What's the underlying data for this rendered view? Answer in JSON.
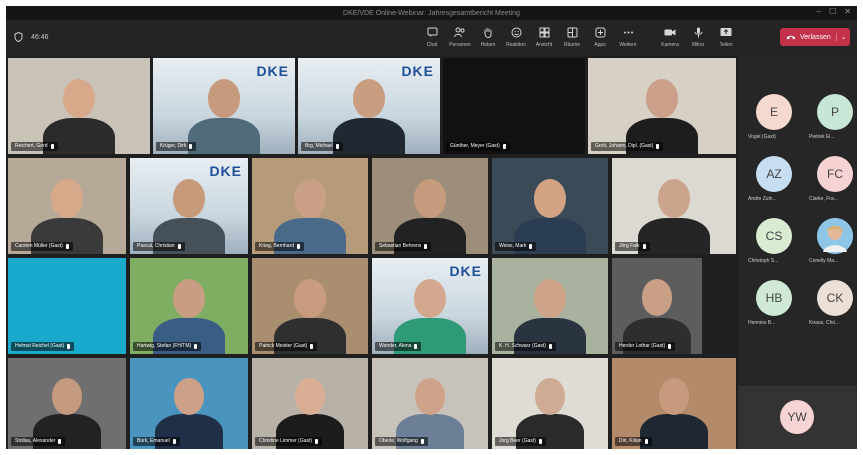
{
  "window": {
    "title": "DKE/VDE Online-Webinar: Jahresgesamtbericht Meeting",
    "controls": [
      "–",
      "☐",
      "✕"
    ]
  },
  "toolbar": {
    "shield_icon": "shield-icon",
    "timer": "46:46",
    "buttons": [
      {
        "label": "Chat",
        "icon": "chat-icon"
      },
      {
        "label": "Personen",
        "icon": "people-icon"
      },
      {
        "label": "Heben",
        "icon": "raise-hand-icon"
      },
      {
        "label": "Reaktion",
        "icon": "reaction-icon"
      },
      {
        "label": "Ansicht",
        "icon": "grid-view-icon"
      },
      {
        "label": "Räume",
        "icon": "rooms-icon"
      },
      {
        "label": "Apps",
        "icon": "apps-icon"
      },
      {
        "label": "Weitere",
        "icon": "more-icon"
      },
      {
        "label": "Kamera",
        "icon": "camera-icon"
      },
      {
        "label": "Mikro",
        "icon": "mic-icon"
      },
      {
        "label": "Teilen",
        "icon": "share-icon"
      }
    ],
    "leave_label": "Verlassen"
  },
  "tiles": [
    {
      "name": "Reichert, Gerd",
      "bg": "#c9c2b7",
      "skin": "#d7a98a",
      "shirt": "#2b2b2b",
      "dke": false
    },
    {
      "name": "Krüger, Dirk",
      "bg": "#dfe6ea",
      "skin": "#c69a7c",
      "shirt": "#4f6b7a",
      "dke": true
    },
    {
      "name": "Brg, Michael",
      "bg": "#dfe6ea",
      "skin": "#c99d80",
      "shirt": "#202832",
      "dke": true
    },
    {
      "name": "Günther, Meyer (Gast)",
      "bg": "#111111",
      "skin": "",
      "shirt": "",
      "dke": false
    },
    {
      "name": "Groh, Johann, Dipl. (Gast)",
      "bg": "#d7d0c4",
      "skin": "#caa08a",
      "shirt": "#1d1d1d",
      "dke": false
    },
    {
      "name": "Carsten Müller (Gast)",
      "bg": "#b7a997",
      "skin": "#d6a98a",
      "shirt": "#3a3a3a",
      "dke": false
    },
    {
      "name": "Pascal, Christian",
      "bg": "#dfe6ea",
      "skin": "#c89a7c",
      "shirt": "#465058",
      "dke": true
    },
    {
      "name": "Krieg, Bernhard",
      "bg": "#b69b7a",
      "skin": "#c99f86",
      "shirt": "#4a6a8a",
      "dke": false
    },
    {
      "name": "Sebastian Behrens",
      "bg": "#9c8e7a",
      "skin": "#c79b7d",
      "shirt": "#222222",
      "dke": false
    },
    {
      "name": "Weiss, Mark",
      "bg": "#3a4a57",
      "skin": "#d4a384",
      "shirt": "#2b3d52",
      "dke": false
    },
    {
      "name": "Jörg Falk",
      "bg": "#dcd8d2",
      "skin": "#cca38c",
      "shirt": "#252525",
      "dke": false
    },
    {
      "name": "Helmut Reichel (Gast)",
      "bg": "#19a9cc",
      "skin": "",
      "shirt": "",
      "dke": false
    },
    {
      "name": "Hartwig, Stefan (FH/TM)",
      "bg": "#7fae63",
      "skin": "#c89d82",
      "shirt": "#3a5d86",
      "dke": false
    },
    {
      "name": "Patrick Meister (Gast)",
      "bg": "#a98f70",
      "skin": "#c99b7f",
      "shirt": "#2f2f2f",
      "dke": false
    },
    {
      "name": "Wender, Alena",
      "bg": "#dfe6ea",
      "skin": "#d4a88e",
      "shirt": "#2f9a78",
      "dke": true
    },
    {
      "name": "K. H. Schwarz (Gast)",
      "bg": "#a9b29e",
      "skin": "#cfa388",
      "shirt": "#2a3340",
      "dke": false
    },
    {
      "name": "Herder Lothar (Gast)",
      "bg": "#5d5d5d",
      "skin": "#c99f86",
      "shirt": "#2e2e2e",
      "dke": false
    },
    {
      "name": "Stollau, Alexander",
      "bg": "#6f6f6f",
      "skin": "#c39a7e",
      "shirt": "#222222",
      "dke": false
    },
    {
      "name": "Bürk, Emanuel",
      "bg": "#4a94c0",
      "skin": "#cda088",
      "shirt": "#1f2f48",
      "dke": false
    },
    {
      "name": "Christine Limmer (Gast)",
      "bg": "#b8b1a8",
      "skin": "#d9ae95",
      "shirt": "#1c1c1c",
      "dke": false
    },
    {
      "name": "Oberle, Wolfgang",
      "bg": "#c7c2ba",
      "skin": "#cfa38a",
      "shirt": "#6d7f96",
      "dke": false
    },
    {
      "name": "Jorg Beer (Gast)",
      "bg": "#dfdcd6",
      "skin": "#ceab94",
      "shirt": "#2a2a2a",
      "dke": false
    },
    {
      "name": "Dirl, Kilian",
      "bg": "#b38a6a",
      "skin": "#c79a7d",
      "shirt": "#1f2733",
      "dke": false
    }
  ],
  "sidebar": {
    "participants": [
      {
        "initials": "E",
        "name": "Vogel (Gast)",
        "color": "#f5d9cf",
        "photo": false
      },
      {
        "initials": "P",
        "name": "Pietrek El...",
        "color": "#c7e6d6",
        "photo": false
      },
      {
        "initials": "AZ",
        "name": "Andre Zuln...",
        "color": "#c7ddf2",
        "photo": false
      },
      {
        "initials": "FC",
        "name": "Clarke, Fra...",
        "color": "#f7d2d2",
        "photo": false
      },
      {
        "initials": "CS",
        "name": "Christoph S...",
        "color": "#d8ecd2",
        "photo": false
      },
      {
        "initials": "",
        "name": "Conelly Ma...",
        "color": "#8fc6e8",
        "photo": true
      },
      {
        "initials": "HB",
        "name": "Hennies B...",
        "color": "#cfe9d6",
        "photo": false
      },
      {
        "initials": "CK",
        "name": "Knaus, Chri...",
        "color": "#ece0d6",
        "photo": false
      }
    ],
    "self": {
      "initials": "YW",
      "color": "#f6d4d4"
    }
  }
}
